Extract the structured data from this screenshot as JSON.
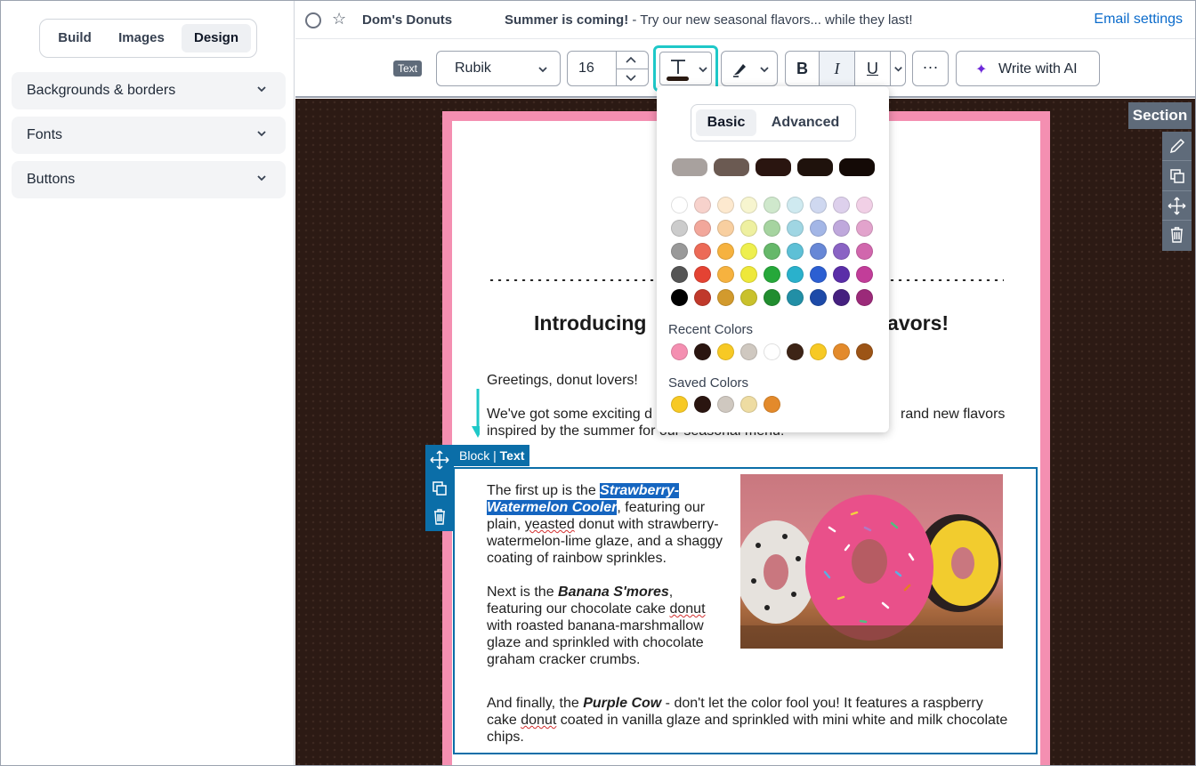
{
  "left_panel": {
    "tabs": [
      "Build",
      "Images",
      "Design"
    ],
    "active_tab": "Design",
    "sections": [
      "Backgrounds & borders",
      "Fonts",
      "Buttons"
    ]
  },
  "header": {
    "sender": "Dom's Donuts",
    "subject_bold": "Summer is coming!",
    "subject_rest": " - Try our new seasonal flavors... while they last!",
    "email_settings": "Email settings"
  },
  "toolbar": {
    "text_tag": "Text",
    "font": "Rubik",
    "size": "16",
    "text_color_hex": "#2a1a12",
    "bold": "B",
    "italic": "I",
    "underline": "U",
    "more": "···",
    "write_ai": "Write with AI"
  },
  "email": {
    "headline_left": "Introducing",
    "headline_right": "flavors!",
    "greeting": "Greetings, donut lovers!",
    "intro_left": "We've got some exciting d",
    "intro_right": "rand new flavors",
    "intro_line2": "inspired by the summer fo",
    "intro_line2_tail": "r our seasonal menu!",
    "p1_a": "The first up is the ",
    "p1_highlight": "Strawberry-Watermelon Cooler",
    "p1_b": ", featuring our plain, ",
    "p1_squig": "yeasted",
    "p1_c": " donut with strawberry-watermelon-lime glaze, and a shaggy coating of rainbow sprinkles.",
    "p2_a": "Next is the ",
    "p2_bold": "Banana S'mores",
    "p2_b": ", featuring our chocolate cake ",
    "p2_squig": "donut",
    "p2_c": " with roasted banana-marshmallow glaze and sprinkled with chocolate graham cracker crumbs.",
    "p3_a": "And finally, the ",
    "p3_bold": "Purple Cow",
    "p3_b": " - don't let the color fool you! It features a raspberry cake ",
    "p3_squig": "donut",
    "p3_c": " coated in vanilla glaze and sprinkled with mini white and milk chocolate chips."
  },
  "block_label": {
    "block": "Block",
    "text": "Text"
  },
  "section_label": "Section",
  "picker": {
    "tabs": [
      "Basic",
      "Advanced"
    ],
    "active_tab": "Basic",
    "brand_colors": [
      "#a8a19e",
      "#6b5a52",
      "#2a1510",
      "#1f120c",
      "#140a06"
    ],
    "grid": [
      [
        "#ffffff",
        "#f7d2cc",
        "#fde9cf",
        "#f7f5cf",
        "#cfe8cc",
        "#cfeaf0",
        "#cfd8f0",
        "#ddd0ec",
        "#f1d0e6"
      ],
      [
        "#cccccc",
        "#f2a79b",
        "#f8cfa0",
        "#eef0a0",
        "#a6d4a0",
        "#a0d6e3",
        "#a3b6e6",
        "#bfa8dc",
        "#e2a3cc"
      ],
      [
        "#999999",
        "#ec6a57",
        "#f6b23f",
        "#eeef4e",
        "#66b86a",
        "#5ec0d6",
        "#6787d6",
        "#8a63c4",
        "#d167ad"
      ],
      [
        "#555555",
        "#e44333",
        "#f6b23f",
        "#eee83a",
        "#26a83a",
        "#2ab1cc",
        "#2c5fd2",
        "#5a2ea8",
        "#c23d99"
      ],
      [
        "#000000",
        "#c0392b",
        "#d29a2d",
        "#c9c12c",
        "#218d2f",
        "#228fa6",
        "#1d4aa8",
        "#45207f",
        "#9b2a79"
      ]
    ],
    "recent_title": "Recent Colors",
    "recent": [
      "#f48fb1",
      "#2a1510",
      "#f7c924",
      "#cfc8c0",
      "#ffffff",
      "#3d2416",
      "#f7c924",
      "#e38a2b",
      "#9c5416"
    ],
    "saved_title": "Saved Colors",
    "saved": [
      "#f7c924",
      "#2a1510",
      "#cfc8c0",
      "#eedca2",
      "#e38a2b"
    ]
  }
}
